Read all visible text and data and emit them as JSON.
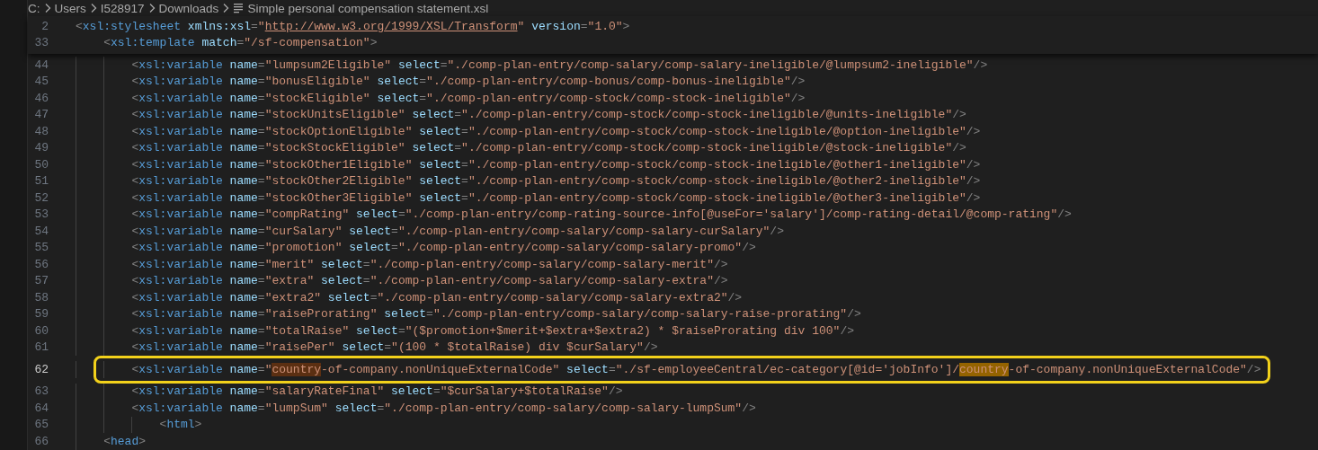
{
  "breadcrumbs": [
    {
      "text": "C:",
      "kind": "folder"
    },
    {
      "text": "Users",
      "kind": "folder"
    },
    {
      "text": "I528917",
      "kind": "folder"
    },
    {
      "text": "Downloads",
      "kind": "folder"
    },
    {
      "text": "Simple personal compensation statement.xsl",
      "kind": "file"
    }
  ],
  "lines": [
    {
      "number": "2",
      "sticky": true,
      "current": false,
      "framed": false,
      "tokens": [
        {
          "kind": "punct",
          "text": "<"
        },
        {
          "kind": "tag",
          "text": "xsl:stylesheet"
        },
        {
          "kind": "attr",
          "text": " xmlns:xsl"
        },
        {
          "kind": "punct",
          "text": "="
        },
        {
          "kind": "string",
          "text": "\""
        },
        {
          "kind": "url",
          "text": "http://www.w3.org/1999/XSL/Transform"
        },
        {
          "kind": "string",
          "text": "\""
        },
        {
          "kind": "attr",
          "text": " version"
        },
        {
          "kind": "punct",
          "text": "="
        },
        {
          "kind": "string",
          "text": "\"1.0\""
        },
        {
          "kind": "punct",
          "text": ">"
        }
      ],
      "children": [
        {
          "number": "33",
          "sticky": true,
          "current": false,
          "framed": false,
          "tokens": [
            {
              "kind": "punct",
              "text": "<"
            },
            {
              "kind": "tag",
              "text": "xsl:template"
            },
            {
              "kind": "attr",
              "text": " match"
            },
            {
              "kind": "punct",
              "text": "="
            },
            {
              "kind": "string",
              "text": "\"/sf-compensation\""
            },
            {
              "kind": "punct",
              "text": ">"
            }
          ],
          "children": [
            {
              "number": "44",
              "sticky": false,
              "current": false,
              "framed": false,
              "tokens": [
                {
                  "kind": "punct",
                  "text": "<"
                },
                {
                  "kind": "tag",
                  "text": "xsl:variable"
                },
                {
                  "kind": "attr",
                  "text": " name"
                },
                {
                  "kind": "punct",
                  "text": "="
                },
                {
                  "kind": "string",
                  "text": "\"lumpsum2Eligible\""
                },
                {
                  "kind": "attr",
                  "text": " select"
                },
                {
                  "kind": "punct",
                  "text": "="
                },
                {
                  "kind": "string",
                  "text": "\"./comp-plan-entry/comp-salary/comp-salary-ineligible/@lumpsum2-ineligible\""
                },
                {
                  "kind": "punct",
                  "text": "/>"
                }
              ]
            },
            {
              "number": "45",
              "sticky": false,
              "current": false,
              "framed": false,
              "tokens": [
                {
                  "kind": "punct",
                  "text": "<"
                },
                {
                  "kind": "tag",
                  "text": "xsl:variable"
                },
                {
                  "kind": "attr",
                  "text": " name"
                },
                {
                  "kind": "punct",
                  "text": "="
                },
                {
                  "kind": "string",
                  "text": "\"bonusEligible\""
                },
                {
                  "kind": "attr",
                  "text": " select"
                },
                {
                  "kind": "punct",
                  "text": "="
                },
                {
                  "kind": "string",
                  "text": "\"./comp-plan-entry/comp-bonus/comp-bonus-ineligible\""
                },
                {
                  "kind": "punct",
                  "text": "/>"
                }
              ]
            },
            {
              "number": "46",
              "sticky": false,
              "current": false,
              "framed": false,
              "tokens": [
                {
                  "kind": "punct",
                  "text": "<"
                },
                {
                  "kind": "tag",
                  "text": "xsl:variable"
                },
                {
                  "kind": "attr",
                  "text": " name"
                },
                {
                  "kind": "punct",
                  "text": "="
                },
                {
                  "kind": "string",
                  "text": "\"stockEligible\""
                },
                {
                  "kind": "attr",
                  "text": " select"
                },
                {
                  "kind": "punct",
                  "text": "="
                },
                {
                  "kind": "string",
                  "text": "\"./comp-plan-entry/comp-stock/comp-stock-ineligible\""
                },
                {
                  "kind": "punct",
                  "text": "/>"
                }
              ]
            },
            {
              "number": "47",
              "sticky": false,
              "current": false,
              "framed": false,
              "tokens": [
                {
                  "kind": "punct",
                  "text": "<"
                },
                {
                  "kind": "tag",
                  "text": "xsl:variable"
                },
                {
                  "kind": "attr",
                  "text": " name"
                },
                {
                  "kind": "punct",
                  "text": "="
                },
                {
                  "kind": "string",
                  "text": "\"stockUnitsEligible\""
                },
                {
                  "kind": "attr",
                  "text": " select"
                },
                {
                  "kind": "punct",
                  "text": "="
                },
                {
                  "kind": "string",
                  "text": "\"./comp-plan-entry/comp-stock/comp-stock-ineligible/@units-ineligible\""
                },
                {
                  "kind": "punct",
                  "text": "/>"
                }
              ]
            },
            {
              "number": "48",
              "sticky": false,
              "current": false,
              "framed": false,
              "tokens": [
                {
                  "kind": "punct",
                  "text": "<"
                },
                {
                  "kind": "tag",
                  "text": "xsl:variable"
                },
                {
                  "kind": "attr",
                  "text": " name"
                },
                {
                  "kind": "punct",
                  "text": "="
                },
                {
                  "kind": "string",
                  "text": "\"stockOptionEligible\""
                },
                {
                  "kind": "attr",
                  "text": " select"
                },
                {
                  "kind": "punct",
                  "text": "="
                },
                {
                  "kind": "string",
                  "text": "\"./comp-plan-entry/comp-stock/comp-stock-ineligible/@option-ineligible\""
                },
                {
                  "kind": "punct",
                  "text": "/>"
                }
              ]
            },
            {
              "number": "49",
              "sticky": false,
              "current": false,
              "framed": false,
              "tokens": [
                {
                  "kind": "punct",
                  "text": "<"
                },
                {
                  "kind": "tag",
                  "text": "xsl:variable"
                },
                {
                  "kind": "attr",
                  "text": " name"
                },
                {
                  "kind": "punct",
                  "text": "="
                },
                {
                  "kind": "string",
                  "text": "\"stockStockEligible\""
                },
                {
                  "kind": "attr",
                  "text": " select"
                },
                {
                  "kind": "punct",
                  "text": "="
                },
                {
                  "kind": "string",
                  "text": "\"./comp-plan-entry/comp-stock/comp-stock-ineligible/@stock-ineligible\""
                },
                {
                  "kind": "punct",
                  "text": "/>"
                }
              ]
            },
            {
              "number": "50",
              "sticky": false,
              "current": false,
              "framed": false,
              "tokens": [
                {
                  "kind": "punct",
                  "text": "<"
                },
                {
                  "kind": "tag",
                  "text": "xsl:variable"
                },
                {
                  "kind": "attr",
                  "text": " name"
                },
                {
                  "kind": "punct",
                  "text": "="
                },
                {
                  "kind": "string",
                  "text": "\"stockOther1Eligible\""
                },
                {
                  "kind": "attr",
                  "text": " select"
                },
                {
                  "kind": "punct",
                  "text": "="
                },
                {
                  "kind": "string",
                  "text": "\"./comp-plan-entry/comp-stock/comp-stock-ineligible/@other1-ineligible\""
                },
                {
                  "kind": "punct",
                  "text": "/>"
                }
              ]
            },
            {
              "number": "51",
              "sticky": false,
              "current": false,
              "framed": false,
              "tokens": [
                {
                  "kind": "punct",
                  "text": "<"
                },
                {
                  "kind": "tag",
                  "text": "xsl:variable"
                },
                {
                  "kind": "attr",
                  "text": " name"
                },
                {
                  "kind": "punct",
                  "text": "="
                },
                {
                  "kind": "string",
                  "text": "\"stockOther2Eligible\""
                },
                {
                  "kind": "attr",
                  "text": " select"
                },
                {
                  "kind": "punct",
                  "text": "="
                },
                {
                  "kind": "string",
                  "text": "\"./comp-plan-entry/comp-stock/comp-stock-ineligible/@other2-ineligible\""
                },
                {
                  "kind": "punct",
                  "text": "/>"
                }
              ]
            },
            {
              "number": "52",
              "sticky": false,
              "current": false,
              "framed": false,
              "tokens": [
                {
                  "kind": "punct",
                  "text": "<"
                },
                {
                  "kind": "tag",
                  "text": "xsl:variable"
                },
                {
                  "kind": "attr",
                  "text": " name"
                },
                {
                  "kind": "punct",
                  "text": "="
                },
                {
                  "kind": "string",
                  "text": "\"stockOther3Eligible\""
                },
                {
                  "kind": "attr",
                  "text": " select"
                },
                {
                  "kind": "punct",
                  "text": "="
                },
                {
                  "kind": "string",
                  "text": "\"./comp-plan-entry/comp-stock/comp-stock-ineligible/@other3-ineligible\""
                },
                {
                  "kind": "punct",
                  "text": "/>"
                }
              ]
            },
            {
              "number": "53",
              "sticky": false,
              "current": false,
              "framed": false,
              "tokens": [
                {
                  "kind": "punct",
                  "text": "<"
                },
                {
                  "kind": "tag",
                  "text": "xsl:variable"
                },
                {
                  "kind": "attr",
                  "text": " name"
                },
                {
                  "kind": "punct",
                  "text": "="
                },
                {
                  "kind": "string",
                  "text": "\"compRating\""
                },
                {
                  "kind": "attr",
                  "text": " select"
                },
                {
                  "kind": "punct",
                  "text": "="
                },
                {
                  "kind": "string",
                  "text": "\"./comp-plan-entry/comp-rating-source-info[@useFor='salary']/comp-rating-detail/@comp-rating\""
                },
                {
                  "kind": "punct",
                  "text": "/>"
                }
              ]
            },
            {
              "number": "54",
              "sticky": false,
              "current": false,
              "framed": false,
              "tokens": [
                {
                  "kind": "punct",
                  "text": "<"
                },
                {
                  "kind": "tag",
                  "text": "xsl:variable"
                },
                {
                  "kind": "attr",
                  "text": " name"
                },
                {
                  "kind": "punct",
                  "text": "="
                },
                {
                  "kind": "string",
                  "text": "\"curSalary\""
                },
                {
                  "kind": "attr",
                  "text": " select"
                },
                {
                  "kind": "punct",
                  "text": "="
                },
                {
                  "kind": "string",
                  "text": "\"./comp-plan-entry/comp-salary/comp-salary-curSalary\""
                },
                {
                  "kind": "punct",
                  "text": "/>"
                }
              ]
            },
            {
              "number": "55",
              "sticky": false,
              "current": false,
              "framed": false,
              "tokens": [
                {
                  "kind": "punct",
                  "text": "<"
                },
                {
                  "kind": "tag",
                  "text": "xsl:variable"
                },
                {
                  "kind": "attr",
                  "text": " name"
                },
                {
                  "kind": "punct",
                  "text": "="
                },
                {
                  "kind": "string",
                  "text": "\"promotion\""
                },
                {
                  "kind": "attr",
                  "text": " select"
                },
                {
                  "kind": "punct",
                  "text": "="
                },
                {
                  "kind": "string",
                  "text": "\"./comp-plan-entry/comp-salary/comp-salary-promo\""
                },
                {
                  "kind": "punct",
                  "text": "/>"
                }
              ]
            },
            {
              "number": "56",
              "sticky": false,
              "current": false,
              "framed": false,
              "tokens": [
                {
                  "kind": "punct",
                  "text": "<"
                },
                {
                  "kind": "tag",
                  "text": "xsl:variable"
                },
                {
                  "kind": "attr",
                  "text": " name"
                },
                {
                  "kind": "punct",
                  "text": "="
                },
                {
                  "kind": "string",
                  "text": "\"merit\""
                },
                {
                  "kind": "attr",
                  "text": " select"
                },
                {
                  "kind": "punct",
                  "text": "="
                },
                {
                  "kind": "string",
                  "text": "\"./comp-plan-entry/comp-salary/comp-salary-merit\""
                },
                {
                  "kind": "punct",
                  "text": "/>"
                }
              ]
            },
            {
              "number": "57",
              "sticky": false,
              "current": false,
              "framed": false,
              "tokens": [
                {
                  "kind": "punct",
                  "text": "<"
                },
                {
                  "kind": "tag",
                  "text": "xsl:variable"
                },
                {
                  "kind": "attr",
                  "text": " name"
                },
                {
                  "kind": "punct",
                  "text": "="
                },
                {
                  "kind": "string",
                  "text": "\"extra\""
                },
                {
                  "kind": "attr",
                  "text": " select"
                },
                {
                  "kind": "punct",
                  "text": "="
                },
                {
                  "kind": "string",
                  "text": "\"./comp-plan-entry/comp-salary/comp-salary-extra\""
                },
                {
                  "kind": "punct",
                  "text": "/>"
                }
              ]
            },
            {
              "number": "58",
              "sticky": false,
              "current": false,
              "framed": false,
              "tokens": [
                {
                  "kind": "punct",
                  "text": "<"
                },
                {
                  "kind": "tag",
                  "text": "xsl:variable"
                },
                {
                  "kind": "attr",
                  "text": " name"
                },
                {
                  "kind": "punct",
                  "text": "="
                },
                {
                  "kind": "string",
                  "text": "\"extra2\""
                },
                {
                  "kind": "attr",
                  "text": " select"
                },
                {
                  "kind": "punct",
                  "text": "="
                },
                {
                  "kind": "string",
                  "text": "\"./comp-plan-entry/comp-salary/comp-salary-extra2\""
                },
                {
                  "kind": "punct",
                  "text": "/>"
                }
              ]
            },
            {
              "number": "59",
              "sticky": false,
              "current": false,
              "framed": false,
              "tokens": [
                {
                  "kind": "punct",
                  "text": "<"
                },
                {
                  "kind": "tag",
                  "text": "xsl:variable"
                },
                {
                  "kind": "attr",
                  "text": " name"
                },
                {
                  "kind": "punct",
                  "text": "="
                },
                {
                  "kind": "string",
                  "text": "\"raiseProrating\""
                },
                {
                  "kind": "attr",
                  "text": " select"
                },
                {
                  "kind": "punct",
                  "text": "="
                },
                {
                  "kind": "string",
                  "text": "\"./comp-plan-entry/comp-salary/comp-salary-raise-prorating\""
                },
                {
                  "kind": "punct",
                  "text": "/>"
                }
              ]
            },
            {
              "number": "60",
              "sticky": false,
              "current": false,
              "framed": false,
              "tokens": [
                {
                  "kind": "punct",
                  "text": "<"
                },
                {
                  "kind": "tag",
                  "text": "xsl:variable"
                },
                {
                  "kind": "attr",
                  "text": " name"
                },
                {
                  "kind": "punct",
                  "text": "="
                },
                {
                  "kind": "string",
                  "text": "\"totalRaise\""
                },
                {
                  "kind": "attr",
                  "text": " select"
                },
                {
                  "kind": "punct",
                  "text": "="
                },
                {
                  "kind": "string",
                  "text": "\"($promotion+$merit+$extra+$extra2) * $raiseProrating div 100\""
                },
                {
                  "kind": "punct",
                  "text": "/>"
                }
              ]
            },
            {
              "number": "61",
              "sticky": false,
              "current": false,
              "framed": false,
              "tokens": [
                {
                  "kind": "punct",
                  "text": "<"
                },
                {
                  "kind": "tag",
                  "text": "xsl:variable"
                },
                {
                  "kind": "attr",
                  "text": " name"
                },
                {
                  "kind": "punct",
                  "text": "="
                },
                {
                  "kind": "string",
                  "text": "\"raisePer\""
                },
                {
                  "kind": "attr",
                  "text": " select"
                },
                {
                  "kind": "punct",
                  "text": "="
                },
                {
                  "kind": "string",
                  "text": "\"(100 * $totalRaise) div $curSalary\""
                },
                {
                  "kind": "punct",
                  "text": "/>"
                }
              ]
            },
            {
              "number": "62",
              "sticky": false,
              "current": true,
              "framed": true,
              "tokens": [
                {
                  "kind": "punct",
                  "text": "<"
                },
                {
                  "kind": "tag",
                  "text": "xsl:variable"
                },
                {
                  "kind": "attr",
                  "text": " name"
                },
                {
                  "kind": "punct",
                  "text": "="
                },
                {
                  "kind": "string",
                  "text": "\""
                },
                {
                  "kind": "selection",
                  "text": "country"
                },
                {
                  "kind": "string",
                  "text": "-of-company.nonUniqueExternalCode\""
                },
                {
                  "kind": "attr",
                  "text": " select"
                },
                {
                  "kind": "punct",
                  "text": "="
                },
                {
                  "kind": "string",
                  "text": "\"./sf-employeeCentral/ec-category[@id='jobInfo']/"
                },
                {
                  "kind": "match",
                  "text": "country"
                },
                {
                  "kind": "string",
                  "text": "-of-company.nonUniqueExternalCode\""
                },
                {
                  "kind": "punct",
                  "text": "/>"
                }
              ]
            },
            {
              "number": "63",
              "sticky": false,
              "current": false,
              "framed": false,
              "tokens": [
                {
                  "kind": "punct",
                  "text": "<"
                },
                {
                  "kind": "tag",
                  "text": "xsl:variable"
                },
                {
                  "kind": "attr",
                  "text": " name"
                },
                {
                  "kind": "punct",
                  "text": "="
                },
                {
                  "kind": "string",
                  "text": "\"salaryRateFinal\""
                },
                {
                  "kind": "attr",
                  "text": " select"
                },
                {
                  "kind": "punct",
                  "text": "="
                },
                {
                  "kind": "string",
                  "text": "\"$curSalary+$totalRaise\""
                },
                {
                  "kind": "punct",
                  "text": "/>"
                }
              ]
            },
            {
              "number": "64",
              "sticky": false,
              "current": false,
              "framed": false,
              "tokens": [
                {
                  "kind": "punct",
                  "text": "<"
                },
                {
                  "kind": "tag",
                  "text": "xsl:variable"
                },
                {
                  "kind": "attr",
                  "text": " name"
                },
                {
                  "kind": "punct",
                  "text": "="
                },
                {
                  "kind": "string",
                  "text": "\"lumpSum\""
                },
                {
                  "kind": "attr",
                  "text": " select"
                },
                {
                  "kind": "punct",
                  "text": "="
                },
                {
                  "kind": "string",
                  "text": "\"./comp-plan-entry/comp-salary/comp-salary-lumpSum\""
                },
                {
                  "kind": "punct",
                  "text": "/>"
                }
              ],
              "children": [
                {
                  "number": "65",
                  "sticky": false,
                  "current": false,
                  "framed": false,
                  "tokens": [
                    {
                      "kind": "punct",
                      "text": "<"
                    },
                    {
                      "kind": "tag",
                      "text": "html"
                    },
                    {
                      "kind": "punct",
                      "text": ">"
                    }
                  ]
                }
              ]
            }
          ]
        },
        {
          "number": "66",
          "sticky": false,
          "current": false,
          "framed": false,
          "tokens": [
            {
              "kind": "punct",
              "text": "<"
            },
            {
              "kind": "tag",
              "text": "head"
            },
            {
              "kind": "punct",
              "text": ">"
            }
          ]
        }
      ]
    }
  ]
}
